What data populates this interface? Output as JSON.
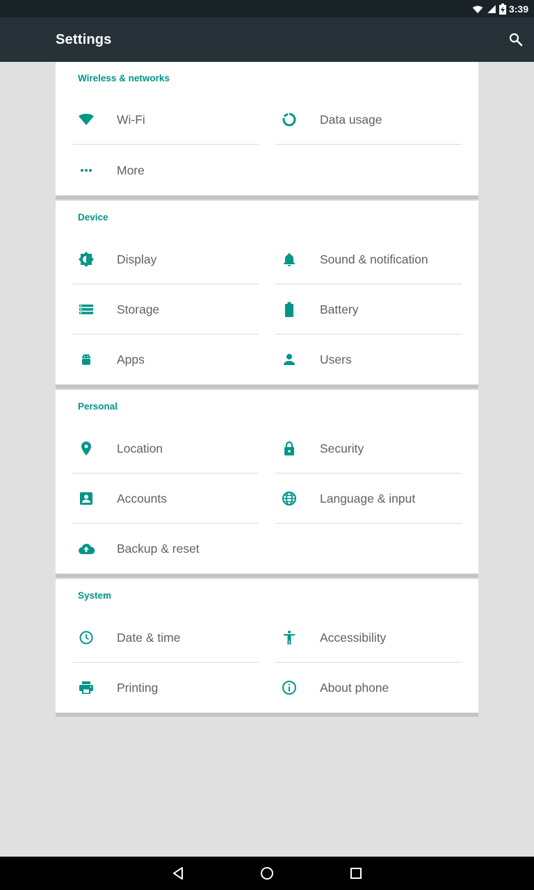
{
  "status_bar": {
    "time": "3:39"
  },
  "app_bar": {
    "title": "Settings",
    "search_icon": "search-icon"
  },
  "colors": {
    "accent": "#009688",
    "app_bar": "#263238",
    "status_bar": "#1a2327",
    "background": "#e0e0e0"
  },
  "sections": {
    "wireless": {
      "title": "Wireless & networks",
      "wifi": "Wi-Fi",
      "data_usage": "Data usage",
      "more": "More"
    },
    "device": {
      "title": "Device",
      "display": "Display",
      "sound": "Sound & notification",
      "storage": "Storage",
      "battery": "Battery",
      "apps": "Apps",
      "users": "Users"
    },
    "personal": {
      "title": "Personal",
      "location": "Location",
      "security": "Security",
      "accounts": "Accounts",
      "language": "Language & input",
      "backup": "Backup & reset"
    },
    "system": {
      "title": "System",
      "date_time": "Date & time",
      "accessibility": "Accessibility",
      "printing": "Printing",
      "about": "About phone"
    }
  }
}
